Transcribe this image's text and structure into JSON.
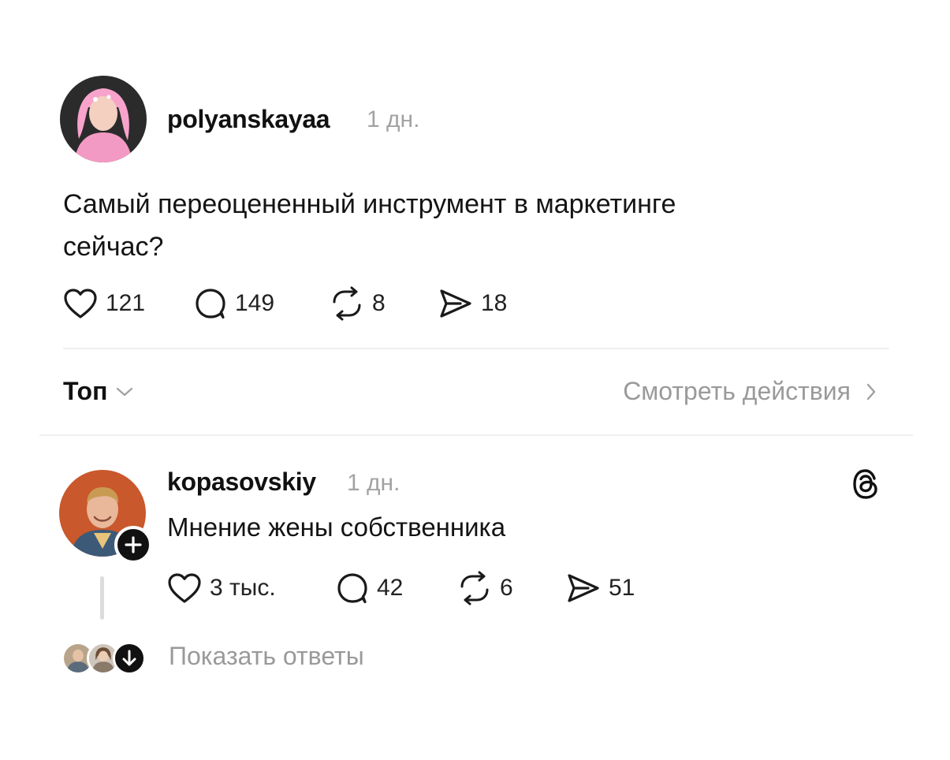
{
  "post": {
    "username": "polyanskayaa",
    "time": "1 дн.",
    "text_line1": "Самый переоцененный инструмент в маркетинге",
    "text_line2": "сейчас?",
    "likes": "121",
    "comments": "149",
    "reposts": "8",
    "shares": "18"
  },
  "sort_bar": {
    "label": "Топ",
    "activity_label": "Смотреть действия"
  },
  "reply": {
    "username": "kopasovskiy",
    "time": "1 дн.",
    "text": "Мнение жены собственника",
    "likes": "3 тыс.",
    "comments": "42",
    "reposts": "6",
    "shares": "51",
    "show_replies_label": "Показать ответы"
  },
  "icons": {
    "like": "heart-icon",
    "comment": "comment-bubble-icon",
    "repost": "repost-icon",
    "share": "send-icon",
    "sort": "chevron-down-icon",
    "activity": "chevron-right-icon",
    "follow": "plus-icon",
    "app": "threads-logo-icon",
    "expand": "arrow-down-icon"
  },
  "colors": {
    "text": "#111111",
    "muted": "#9a9a9a",
    "divider": "#efefef"
  }
}
